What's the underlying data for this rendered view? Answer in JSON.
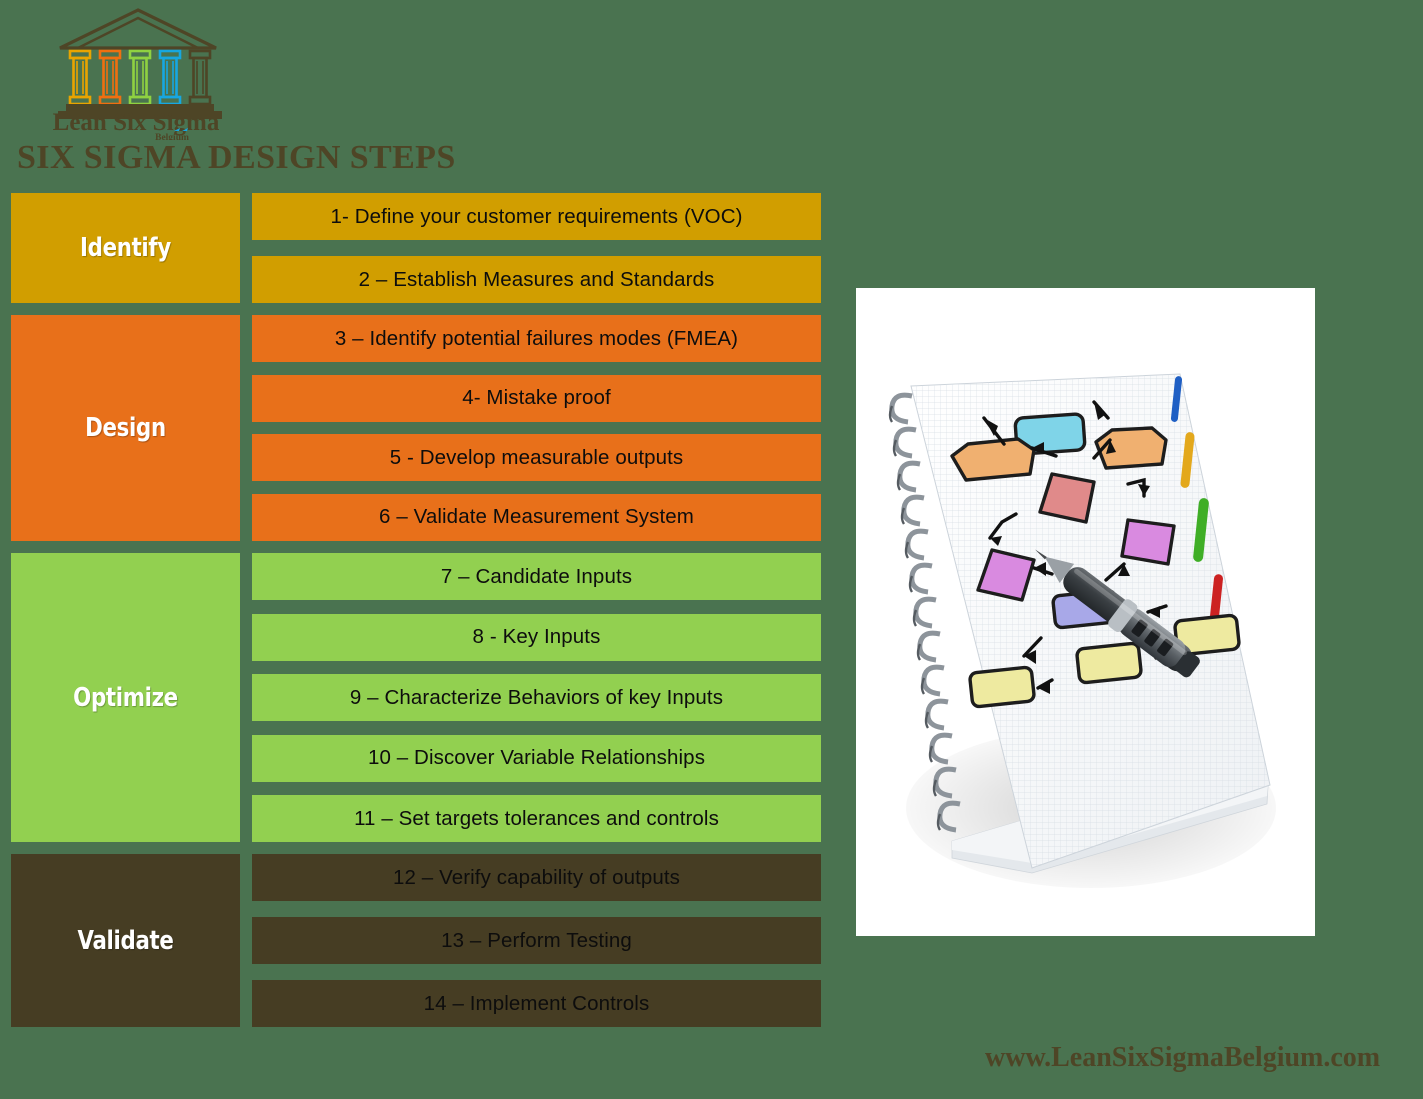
{
  "brand": {
    "logo_name": "lean-six-sigma-belgium-logo",
    "logo_text": "Lean Six Sigma",
    "logo_subtext": "Belgium",
    "column_colors": [
      "#e8a400",
      "#ef6f10",
      "#8fd141",
      "#17a7e0",
      "#4e4526"
    ],
    "temple_color": "#4e4526"
  },
  "header": {
    "title": "SIX SIGMA DESIGN STEPS",
    "title_color": "#4e4526"
  },
  "canvas": {
    "background_color": "#4a7350"
  },
  "phases": [
    {
      "label": "Identify",
      "color": "#d19e00",
      "steps": [
        "1- Define your customer requirements (VOC)",
        "2 – Establish Measures and Standards"
      ]
    },
    {
      "label": "Design",
      "color": "#e8701a",
      "steps": [
        "3 – Identify potential failures modes (FMEA)",
        "4- Mistake proof",
        "5  - Develop measurable outputs",
        "6 – Validate Measurement System"
      ]
    },
    {
      "label": "Optimize",
      "color": "#92d050",
      "steps": [
        "7 – Candidate Inputs",
        "8  - Key Inputs",
        "9 – Characterize Behaviors of key Inputs",
        "10 – Discover Variable Relationships",
        "11 – Set targets tolerances and controls"
      ]
    },
    {
      "label": "Validate",
      "color": "#463d23",
      "steps": [
        "12 – Verify capability of outputs",
        "13 – Perform Testing",
        "14 – Implement Controls"
      ]
    }
  ],
  "illustration": {
    "name": "spiral-notebook-flowchart-photo",
    "description": "Spiral-bound graph-paper notebook with a hand-drawn flowchart and a pen resting on it",
    "frame_color": "#ffffff",
    "tab_colors": [
      "#1f5fc4",
      "#e3a81c",
      "#3fae26",
      "#cc2222"
    ],
    "shape_colors": [
      "#7fd4e8",
      "#f0b070",
      "#e08a8a",
      "#d98ae0",
      "#a8a8e8",
      "#eeeaa0"
    ]
  },
  "footer": {
    "url": "www.LeanSixSigmaBelgium.com",
    "url_color": "#4e4526"
  }
}
